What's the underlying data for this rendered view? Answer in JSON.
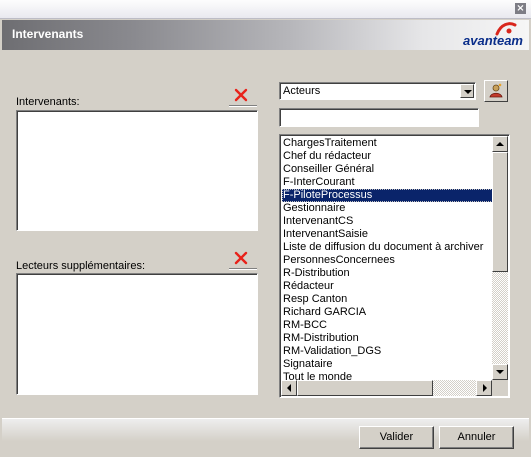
{
  "window": {
    "close_glyph": "×"
  },
  "header": {
    "title": "Intervenants",
    "logo_text": "avanteam"
  },
  "left": {
    "intervenants_label": "Intervenants:",
    "lecteurs_label": "Lecteurs supplémentaires:",
    "delete_icon": "delete-x-icon"
  },
  "right": {
    "combo_value": "Acteurs",
    "filter_value": "",
    "add_icon": "add-actor-icon",
    "items": [
      "ChargesTraitement",
      "Chef du rédacteur",
      "Conseiller Général",
      "F-InterCourant",
      "F-PiloteProcessus",
      "Gestionnaire",
      "IntervenantCS",
      "IntervenantSaisie",
      "Liste de diffusion du document à archiver",
      "PersonnesConcernees",
      "R-Distribution",
      "Rédacteur",
      "Resp Canton",
      "Richard GARCIA",
      "RM-BCC",
      "RM-Distribution",
      "RM-Validation_DGS",
      "Signataire",
      "Tout le monde"
    ],
    "selected_item": "F-PiloteProcessus"
  },
  "footer": {
    "ok_label": "Valider",
    "cancel_label": "Annuler"
  },
  "colors": {
    "selection": "#0a246a",
    "delete_red": "#e8221a",
    "brand_blue": "#0a2e8a",
    "brand_red": "#d9261c"
  }
}
